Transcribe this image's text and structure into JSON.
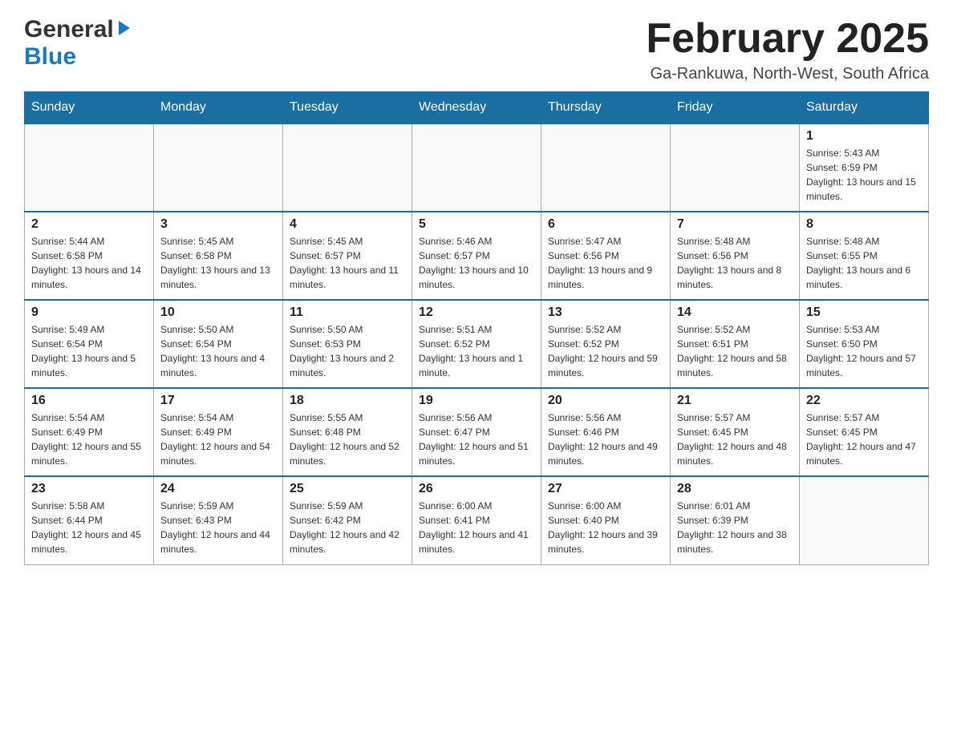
{
  "header": {
    "logo": {
      "general": "General",
      "blue": "Blue",
      "arrow": "▶"
    },
    "title": "February 2025",
    "location": "Ga-Rankuwa, North-West, South Africa"
  },
  "weekdays": [
    "Sunday",
    "Monday",
    "Tuesday",
    "Wednesday",
    "Thursday",
    "Friday",
    "Saturday"
  ],
  "weeks": [
    [
      {
        "day": "",
        "info": ""
      },
      {
        "day": "",
        "info": ""
      },
      {
        "day": "",
        "info": ""
      },
      {
        "day": "",
        "info": ""
      },
      {
        "day": "",
        "info": ""
      },
      {
        "day": "",
        "info": ""
      },
      {
        "day": "1",
        "info": "Sunrise: 5:43 AM\nSunset: 6:59 PM\nDaylight: 13 hours and 15 minutes."
      }
    ],
    [
      {
        "day": "2",
        "info": "Sunrise: 5:44 AM\nSunset: 6:58 PM\nDaylight: 13 hours and 14 minutes."
      },
      {
        "day": "3",
        "info": "Sunrise: 5:45 AM\nSunset: 6:58 PM\nDaylight: 13 hours and 13 minutes."
      },
      {
        "day": "4",
        "info": "Sunrise: 5:45 AM\nSunset: 6:57 PM\nDaylight: 13 hours and 11 minutes."
      },
      {
        "day": "5",
        "info": "Sunrise: 5:46 AM\nSunset: 6:57 PM\nDaylight: 13 hours and 10 minutes."
      },
      {
        "day": "6",
        "info": "Sunrise: 5:47 AM\nSunset: 6:56 PM\nDaylight: 13 hours and 9 minutes."
      },
      {
        "day": "7",
        "info": "Sunrise: 5:48 AM\nSunset: 6:56 PM\nDaylight: 13 hours and 8 minutes."
      },
      {
        "day": "8",
        "info": "Sunrise: 5:48 AM\nSunset: 6:55 PM\nDaylight: 13 hours and 6 minutes."
      }
    ],
    [
      {
        "day": "9",
        "info": "Sunrise: 5:49 AM\nSunset: 6:54 PM\nDaylight: 13 hours and 5 minutes."
      },
      {
        "day": "10",
        "info": "Sunrise: 5:50 AM\nSunset: 6:54 PM\nDaylight: 13 hours and 4 minutes."
      },
      {
        "day": "11",
        "info": "Sunrise: 5:50 AM\nSunset: 6:53 PM\nDaylight: 13 hours and 2 minutes."
      },
      {
        "day": "12",
        "info": "Sunrise: 5:51 AM\nSunset: 6:52 PM\nDaylight: 13 hours and 1 minute."
      },
      {
        "day": "13",
        "info": "Sunrise: 5:52 AM\nSunset: 6:52 PM\nDaylight: 12 hours and 59 minutes."
      },
      {
        "day": "14",
        "info": "Sunrise: 5:52 AM\nSunset: 6:51 PM\nDaylight: 12 hours and 58 minutes."
      },
      {
        "day": "15",
        "info": "Sunrise: 5:53 AM\nSunset: 6:50 PM\nDaylight: 12 hours and 57 minutes."
      }
    ],
    [
      {
        "day": "16",
        "info": "Sunrise: 5:54 AM\nSunset: 6:49 PM\nDaylight: 12 hours and 55 minutes."
      },
      {
        "day": "17",
        "info": "Sunrise: 5:54 AM\nSunset: 6:49 PM\nDaylight: 12 hours and 54 minutes."
      },
      {
        "day": "18",
        "info": "Sunrise: 5:55 AM\nSunset: 6:48 PM\nDaylight: 12 hours and 52 minutes."
      },
      {
        "day": "19",
        "info": "Sunrise: 5:56 AM\nSunset: 6:47 PM\nDaylight: 12 hours and 51 minutes."
      },
      {
        "day": "20",
        "info": "Sunrise: 5:56 AM\nSunset: 6:46 PM\nDaylight: 12 hours and 49 minutes."
      },
      {
        "day": "21",
        "info": "Sunrise: 5:57 AM\nSunset: 6:45 PM\nDaylight: 12 hours and 48 minutes."
      },
      {
        "day": "22",
        "info": "Sunrise: 5:57 AM\nSunset: 6:45 PM\nDaylight: 12 hours and 47 minutes."
      }
    ],
    [
      {
        "day": "23",
        "info": "Sunrise: 5:58 AM\nSunset: 6:44 PM\nDaylight: 12 hours and 45 minutes."
      },
      {
        "day": "24",
        "info": "Sunrise: 5:59 AM\nSunset: 6:43 PM\nDaylight: 12 hours and 44 minutes."
      },
      {
        "day": "25",
        "info": "Sunrise: 5:59 AM\nSunset: 6:42 PM\nDaylight: 12 hours and 42 minutes."
      },
      {
        "day": "26",
        "info": "Sunrise: 6:00 AM\nSunset: 6:41 PM\nDaylight: 12 hours and 41 minutes."
      },
      {
        "day": "27",
        "info": "Sunrise: 6:00 AM\nSunset: 6:40 PM\nDaylight: 12 hours and 39 minutes."
      },
      {
        "day": "28",
        "info": "Sunrise: 6:01 AM\nSunset: 6:39 PM\nDaylight: 12 hours and 38 minutes."
      },
      {
        "day": "",
        "info": ""
      }
    ]
  ]
}
